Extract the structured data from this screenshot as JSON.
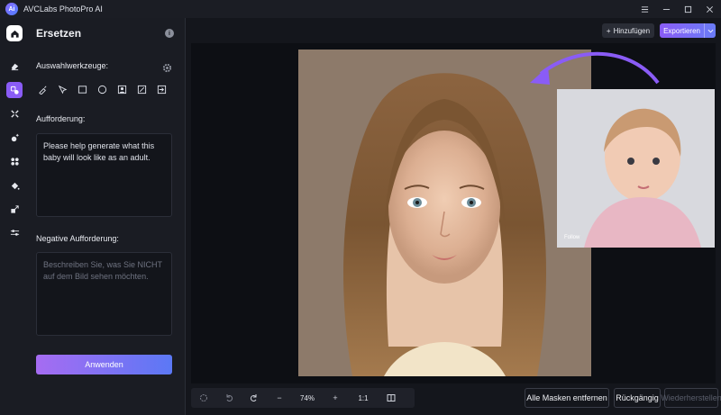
{
  "app": {
    "title": "AVCLabs PhotoPro AI",
    "logo_text": "Ai"
  },
  "panel": {
    "title": "Ersetzen",
    "selection_tools_label": "Auswahlwerkzeuge:",
    "prompt_label": "Aufforderung:",
    "prompt_value": "Please help generate what this baby will look like as an adult.",
    "negative_prompt_label": "Negative Aufforderung:",
    "negative_prompt_placeholder": "Beschreiben Sie, was Sie NICHT auf dem Bild sehen möchten.",
    "apply_button": "Anwenden"
  },
  "toolbar": {
    "add_button": "Hinzufügen",
    "add_icon": "+",
    "export_button": "Exportieren"
  },
  "canvas": {
    "inset_caption": "Follow"
  },
  "bottom": {
    "zoom": "74%",
    "minus": "−",
    "plus": "+",
    "ratio": "1:1",
    "remove_masks": "Alle Masken entfernen",
    "undo": "Rückgängig",
    "redo": "Wiederherstellen"
  },
  "colors": {
    "accent": "#8a5cf6",
    "apply_gradient_start": "#a66cf2",
    "apply_gradient_end": "#5b78f5"
  },
  "icons": {
    "rail": [
      "home-icon",
      "eraser-icon",
      "replace-icon",
      "enhance-icon",
      "sparkle-icon",
      "fan-icon",
      "fill-icon",
      "resize-icon",
      "adjust-icon"
    ],
    "tools": [
      "brush-icon",
      "lasso-icon",
      "rectangle-icon",
      "ellipse-icon",
      "portrait-icon",
      "auto-select-icon",
      "import-icon"
    ]
  }
}
